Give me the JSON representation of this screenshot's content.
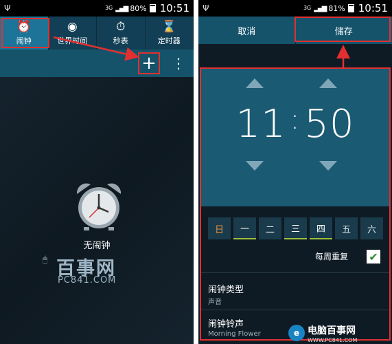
{
  "left_phone": {
    "status": {
      "network": "3G",
      "battery": "80%",
      "time": "10:51"
    },
    "tabs": [
      {
        "label": "闹钟",
        "icon": "alarm-icon",
        "active": true
      },
      {
        "label": "世界时间",
        "icon": "globe-icon",
        "active": false
      },
      {
        "label": "秒表",
        "icon": "stopwatch-icon",
        "active": false
      },
      {
        "label": "定时器",
        "icon": "hourglass-icon",
        "active": false
      }
    ],
    "add_label": "+",
    "more_label": "⋮",
    "empty_label": "无闹钟",
    "watermark": {
      "brand": "百事网",
      "url": "PC841.COM"
    }
  },
  "right_phone": {
    "status": {
      "network": "3G",
      "battery": "81%",
      "time": "10:51"
    },
    "cancel_label": "取消",
    "save_label": "储存",
    "hour": "11",
    "minute": "50",
    "colon": ":",
    "days": [
      {
        "label": "日",
        "selected": false
      },
      {
        "label": "一",
        "selected": true
      },
      {
        "label": "二",
        "selected": false
      },
      {
        "label": "三",
        "selected": true
      },
      {
        "label": "四",
        "selected": true
      },
      {
        "label": "五",
        "selected": false
      },
      {
        "label": "六",
        "selected": false
      }
    ],
    "repeat_label": "每周重复",
    "repeat_checked": true,
    "alarm_type": {
      "title": "闹钟类型",
      "value": "声音"
    },
    "alarm_tone": {
      "title": "闹钟铃声",
      "value": "Morning Flower"
    }
  },
  "footer_brand": {
    "name": "电脑百事网",
    "url": "WWW.PC841.COM"
  },
  "colors": {
    "highlight": "#e23030",
    "accent": "#1c7598",
    "day_on": "#9bc13c"
  }
}
